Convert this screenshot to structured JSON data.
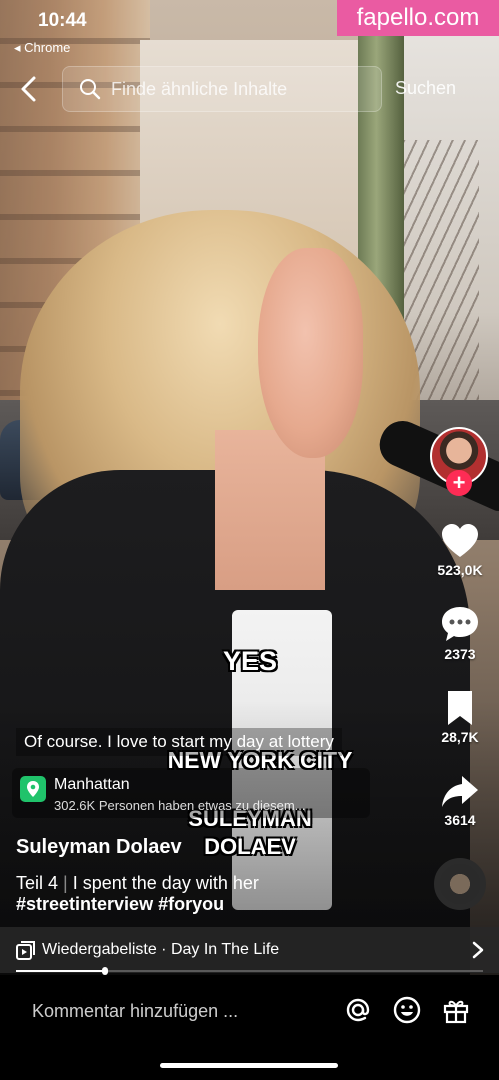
{
  "status_bar": {
    "time": "10:44",
    "back_app": "◂ Chrome"
  },
  "watermark": "fapello.com",
  "search": {
    "placeholder": "Finde ähnliche Inhalte",
    "submit_label": "Suchen"
  },
  "actions": {
    "likes": "523,0K",
    "comments": "2373",
    "saves": "28,7K",
    "shares": "3614"
  },
  "captions": {
    "subtitle": "Of course. I love to start my day at lottery",
    "overlay_yes": "YES",
    "overlay_city": "NEW YORK CITY",
    "overlay_name_1": "SULEYMAN",
    "overlay_name_2": "DOLAEV"
  },
  "location": {
    "name": "Manhattan",
    "subtitle": "302.6K Personen haben etwas zu diesem..."
  },
  "post": {
    "author": "Suleyman Dolaev",
    "part": "Teil 4",
    "separator": "|",
    "description": "I spent the day with her",
    "hashtags": "#streetinterview #foryou"
  },
  "playlist": {
    "label": "Wiedergabeliste · Day In The Life"
  },
  "progress": {
    "fraction": 0.19
  },
  "comment_bar": {
    "placeholder": "Kommentar hinzufügen ..."
  },
  "colors": {
    "accent": "#fe2c55",
    "watermark_bg": "#ea5ba2",
    "location_pin": "#20c36b"
  },
  "icons": [
    "search-icon",
    "back-chevron-icon",
    "heart-icon",
    "comment-icon",
    "bookmark-icon",
    "share-icon",
    "playlist-icon",
    "chevron-right-icon",
    "at-icon",
    "emoji-icon",
    "gift-icon",
    "location-pin-icon"
  ]
}
